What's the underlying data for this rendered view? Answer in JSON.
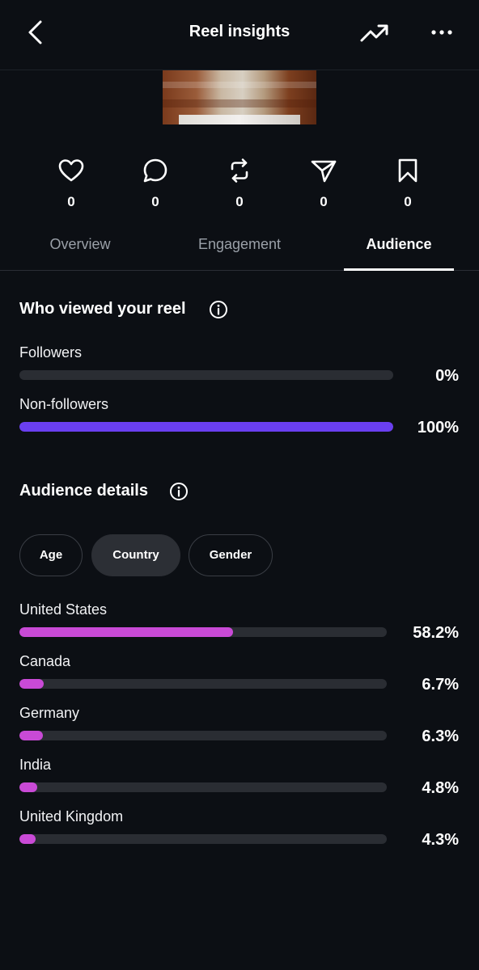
{
  "header": {
    "title": "Reel insights",
    "back_icon": "chevron-left-icon",
    "trend_icon": "trending-up-icon",
    "more_icon": "more-horizontal-icon"
  },
  "metrics": [
    {
      "icon": "heart-icon",
      "value": "0"
    },
    {
      "icon": "comment-icon",
      "value": "0"
    },
    {
      "icon": "repost-icon",
      "value": "0"
    },
    {
      "icon": "share-icon",
      "value": "0"
    },
    {
      "icon": "bookmark-icon",
      "value": "0"
    }
  ],
  "tabs": [
    {
      "label": "Overview",
      "active": false
    },
    {
      "label": "Engagement",
      "active": false
    },
    {
      "label": "Audience",
      "active": true
    }
  ],
  "viewers": {
    "title": "Who viewed your reel",
    "rows": [
      {
        "label": "Followers",
        "value": 0,
        "display": "0%"
      },
      {
        "label": "Non-followers",
        "value": 100,
        "display": "100%"
      }
    ],
    "fill_color": "#6a3ff0"
  },
  "audience": {
    "title": "Audience details",
    "filters": [
      {
        "label": "Age",
        "selected": false
      },
      {
        "label": "Country",
        "selected": true
      },
      {
        "label": "Gender",
        "selected": false
      }
    ],
    "rows": [
      {
        "label": "United States",
        "value": 58.2,
        "display": "58.2%"
      },
      {
        "label": "Canada",
        "value": 6.7,
        "display": "6.7%"
      },
      {
        "label": "Germany",
        "value": 6.3,
        "display": "6.3%"
      },
      {
        "label": "India",
        "value": 4.8,
        "display": "4.8%"
      },
      {
        "label": "United Kingdom",
        "value": 4.3,
        "display": "4.3%"
      }
    ],
    "fill_color": "#c94ad6"
  }
}
